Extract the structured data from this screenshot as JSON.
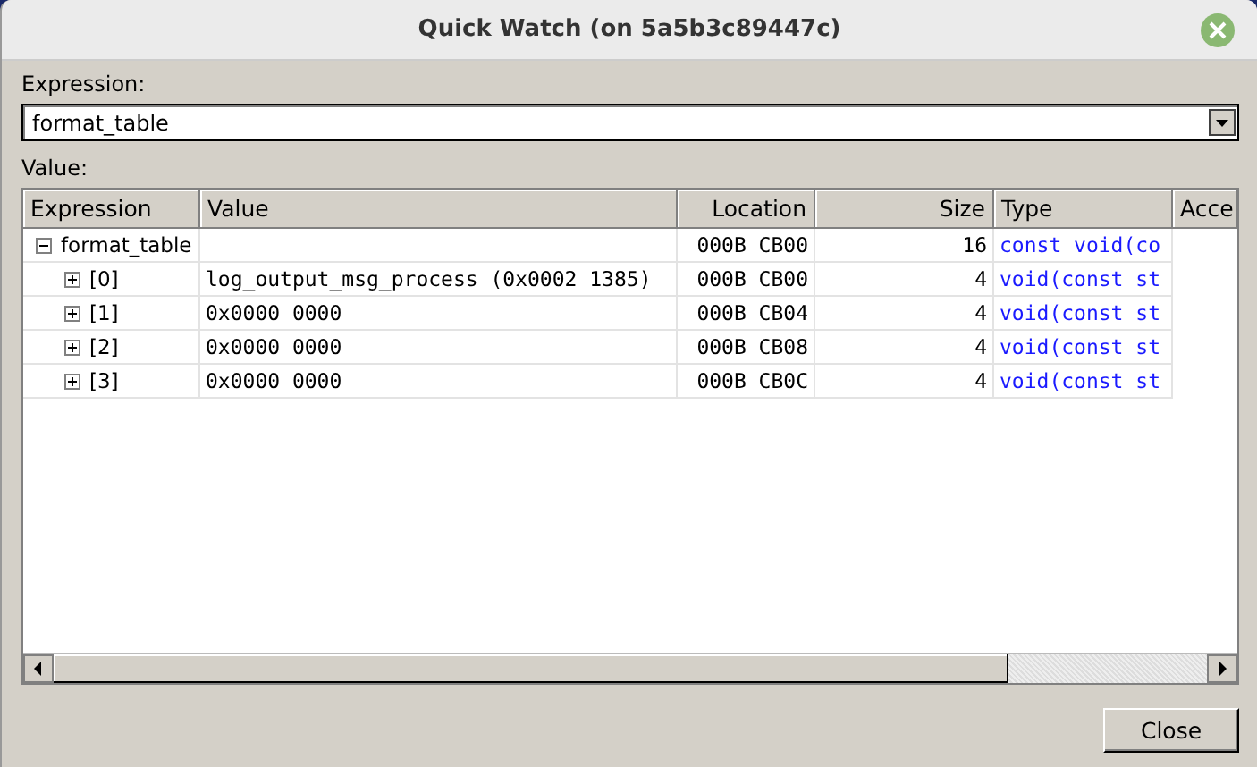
{
  "window": {
    "title": "Quick Watch (on 5a5b3c89447c)"
  },
  "expression": {
    "label": "Expression:",
    "value": "format_table"
  },
  "value_label": "Value:",
  "table": {
    "columns": [
      "Expression",
      "Value",
      "Location",
      "Size",
      "Type",
      "Acce"
    ],
    "rows": [
      {
        "expression": "format_table",
        "value": "",
        "location": "000B CB00",
        "size": "16",
        "type": "const void(co",
        "expanded": true,
        "children": [
          {
            "expression": "[0]",
            "value": "log_output_msg_process (0x0002 1385)",
            "location": "000B CB00",
            "size": "4",
            "type": "void(const st",
            "expanded": false
          },
          {
            "expression": "[1]",
            "value": "0x0000 0000",
            "location": "000B CB04",
            "size": "4",
            "type": "void(const st",
            "expanded": false
          },
          {
            "expression": "[2]",
            "value": "0x0000 0000",
            "location": "000B CB08",
            "size": "4",
            "type": "void(const st",
            "expanded": false
          },
          {
            "expression": "[3]",
            "value": "0x0000 0000",
            "location": "000B CB0C",
            "size": "4",
            "type": "void(const st",
            "expanded": false
          }
        ]
      }
    ]
  },
  "buttons": [
    "Close"
  ]
}
